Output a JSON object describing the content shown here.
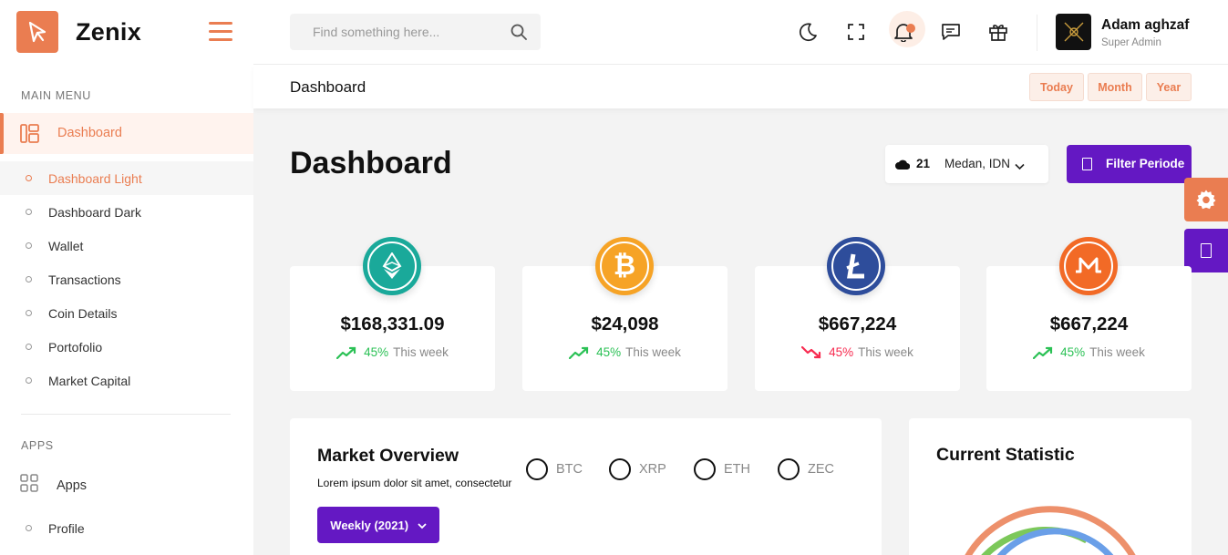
{
  "brand": {
    "name": "Zenix"
  },
  "sidebar": {
    "main_menu_title": "MAIN MENU",
    "dashboard_label": "Dashboard",
    "sub_items": [
      "Dashboard Light",
      "Dashboard Dark",
      "Wallet",
      "Transactions",
      "Coin Details",
      "Portofolio",
      "Market Capital"
    ],
    "apps_title": "APPS",
    "apps_label": "Apps",
    "profile_label": "Profile"
  },
  "header": {
    "search_placeholder": "Find something here...",
    "user_name": "Adam aghzaf",
    "user_role": "Super Admin"
  },
  "subheader": {
    "breadcrumb": "Dashboard",
    "ranges": [
      "Today",
      "Month",
      "Year"
    ]
  },
  "main": {
    "title": "Dashboard",
    "weather_temp": "21",
    "weather_location": "Medan, IDN",
    "filter_label": "Filter Periode"
  },
  "cards": [
    {
      "coin": "ethereum",
      "value": "$168,331.09",
      "pct": "45%",
      "week": "This week",
      "trend": "up",
      "color": "#1aa99a"
    },
    {
      "coin": "bitcoin",
      "value": "$24,098",
      "pct": "45%",
      "week": "This week",
      "trend": "up",
      "color": "#f6a326"
    },
    {
      "coin": "litecoin",
      "value": "$667,224",
      "pct": "45%",
      "week": "This week",
      "trend": "down",
      "color": "#2e4d9b"
    },
    {
      "coin": "monero",
      "value": "$667,224",
      "pct": "45%",
      "week": "This week",
      "trend": "up",
      "color": "#f26a26"
    }
  ],
  "market_overview": {
    "title": "Market Overview",
    "subtitle": "Lorem ipsum dolor sit amet, consectetur",
    "options": [
      "BTC",
      "XRP",
      "ETH",
      "ZEC"
    ],
    "period_label": "Weekly (2021)"
  },
  "current_statistic": {
    "title": "Current Statistic"
  },
  "colors": {
    "accent": "#ea7d51",
    "primary": "#6418c3",
    "up": "#2bc155",
    "down": "#f72b50"
  }
}
